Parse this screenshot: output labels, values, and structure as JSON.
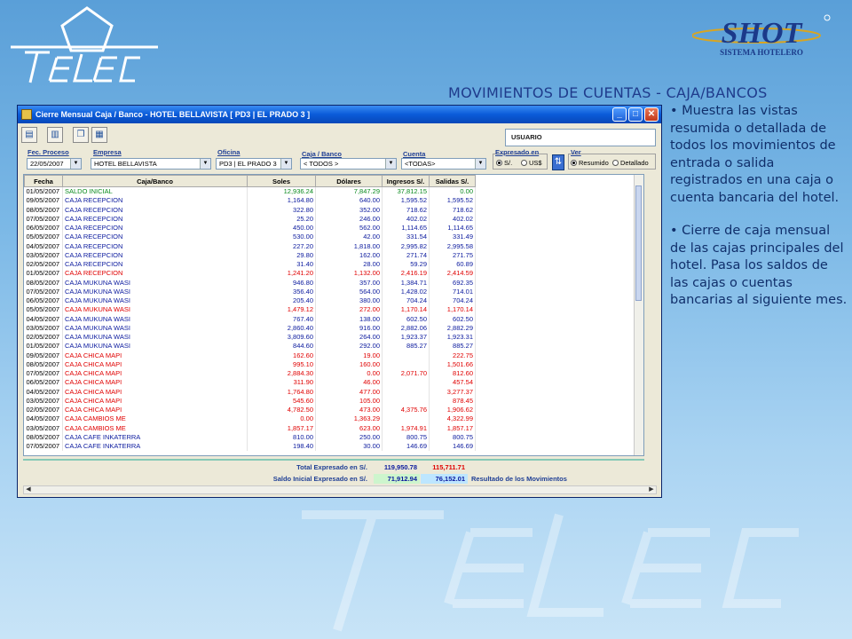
{
  "slide": {
    "title": "MOVIMIENTOS DE CUENTAS - CAJA/BANCOS",
    "brand_left": "TELECSA",
    "brand_right": "SHOT",
    "brand_right_sub": "SISTEMA HOTELERO",
    "bullets": [
      "• Muestra las vistas resumida o detallada de todos los movimientos de entrada o salida registrados en una caja o cuenta bancaria del hotel.",
      "• Cierre de caja mensual de las cajas principales del hotel. Pasa los saldos de las cajas o cuentas bancarias al siguiente mes."
    ]
  },
  "window": {
    "title": "Cierre Mensual Caja / Banco - HOTEL BELLAVISTA  [ PD3  |  EL PRADO 3 ]",
    "usuario_label": "USUARIO"
  },
  "filters": {
    "fec_proceso_label": "Fec. Proceso",
    "fec_proceso_value": "22/05/2007",
    "empresa_label": "Empresa",
    "empresa_value": "HOTEL BELLAVISTA",
    "oficina_label": "Oficina",
    "oficina_value": "PD3  |  EL PRADO 3",
    "caja_label": "Caja / Banco",
    "caja_value": "< TODOS >",
    "cuenta_label": "Cuenta",
    "cuenta_value": "<TODAS>",
    "expresado_label": "Expresado en",
    "expresado_opt1": "S/.",
    "expresado_opt2": "US$",
    "ver_label": "Ver",
    "ver_opt1": "Resumido",
    "ver_opt2": "Detallado"
  },
  "table": {
    "headers": [
      "Fecha",
      "Caja/Banco",
      "Soles",
      "Dólares",
      "Ingresos S/.",
      "Salidas S/."
    ],
    "rows": [
      {
        "fecha": "01/05/2007",
        "caja": "SALDO INICIAL",
        "soles": "12,936.24",
        "dolares": "7,847.29",
        "ingresos": "37,812.15",
        "salidas": "0.00",
        "color": "green"
      },
      {
        "fecha": "09/05/2007",
        "caja": "CAJA RECEPCION",
        "soles": "1,164.80",
        "dolares": "640.00",
        "ingresos": "1,595.52",
        "salidas": "1,595.52",
        "color": "blue"
      },
      {
        "fecha": "08/05/2007",
        "caja": "CAJA RECEPCION",
        "soles": "322.80",
        "dolares": "352.00",
        "ingresos": "718.62",
        "salidas": "718.62",
        "color": "blue"
      },
      {
        "fecha": "07/05/2007",
        "caja": "CAJA RECEPCION",
        "soles": "25.20",
        "dolares": "246.00",
        "ingresos": "402.02",
        "salidas": "402.02",
        "color": "blue"
      },
      {
        "fecha": "06/05/2007",
        "caja": "CAJA RECEPCION",
        "soles": "450.00",
        "dolares": "562.00",
        "ingresos": "1,114.65",
        "salidas": "1,114.65",
        "color": "blue"
      },
      {
        "fecha": "05/05/2007",
        "caja": "CAJA RECEPCION",
        "soles": "530.00",
        "dolares": "42.00",
        "ingresos": "331.54",
        "salidas": "331.49",
        "color": "blue"
      },
      {
        "fecha": "04/05/2007",
        "caja": "CAJA RECEPCION",
        "soles": "227.20",
        "dolares": "1,818.00",
        "ingresos": "2,995.82",
        "salidas": "2,995.58",
        "color": "blue"
      },
      {
        "fecha": "03/05/2007",
        "caja": "CAJA RECEPCION",
        "soles": "29.80",
        "dolares": "162.00",
        "ingresos": "271.74",
        "salidas": "271.75",
        "color": "blue"
      },
      {
        "fecha": "02/05/2007",
        "caja": "CAJA RECEPCION",
        "soles": "31.40",
        "dolares": "28.00",
        "ingresos": "59.29",
        "salidas": "60.89",
        "color": "blue"
      },
      {
        "fecha": "01/05/2007",
        "caja": "CAJA RECEPCION",
        "soles": "1,241.20",
        "dolares": "1,132.00",
        "ingresos": "2,416.19",
        "salidas": "2,414.59",
        "color": "red"
      },
      {
        "fecha": "08/05/2007",
        "caja": "CAJA MUKUNA WASI",
        "soles": "946.80",
        "dolares": "357.00",
        "ingresos": "1,384.71",
        "salidas": "692.35",
        "color": "blue"
      },
      {
        "fecha": "07/05/2007",
        "caja": "CAJA MUKUNA WASI",
        "soles": "356.40",
        "dolares": "564.00",
        "ingresos": "1,428.02",
        "salidas": "714.01",
        "color": "blue"
      },
      {
        "fecha": "06/05/2007",
        "caja": "CAJA MUKUNA WASI",
        "soles": "205.40",
        "dolares": "380.00",
        "ingresos": "704.24",
        "salidas": "704.24",
        "color": "blue"
      },
      {
        "fecha": "05/05/2007",
        "caja": "CAJA MUKUNA WASI",
        "soles": "1,479.12",
        "dolares": "272.00",
        "ingresos": "1,170.14",
        "salidas": "1,170.14",
        "color": "red"
      },
      {
        "fecha": "04/05/2007",
        "caja": "CAJA MUKUNA WASI",
        "soles": "767.40",
        "dolares": "138.00",
        "ingresos": "602.50",
        "salidas": "602.50",
        "color": "blue"
      },
      {
        "fecha": "03/05/2007",
        "caja": "CAJA MUKUNA WASI",
        "soles": "2,860.40",
        "dolares": "916.00",
        "ingresos": "2,882.06",
        "salidas": "2,882.29",
        "color": "blue"
      },
      {
        "fecha": "02/05/2007",
        "caja": "CAJA MUKUNA WASI",
        "soles": "3,809.60",
        "dolares": "264.00",
        "ingresos": "1,923.37",
        "salidas": "1,923.31",
        "color": "blue"
      },
      {
        "fecha": "01/05/2007",
        "caja": "CAJA MUKUNA WASI",
        "soles": "844.60",
        "dolares": "292.00",
        "ingresos": "885.27",
        "salidas": "885.27",
        "color": "blue"
      },
      {
        "fecha": "09/05/2007",
        "caja": "CAJA CHICA MAPI",
        "soles": "162.60",
        "dolares": "19.00",
        "ingresos": "",
        "salidas": "222.75",
        "color": "red"
      },
      {
        "fecha": "08/05/2007",
        "caja": "CAJA CHICA MAPI",
        "soles": "995.10",
        "dolares": "160.00",
        "ingresos": "",
        "salidas": "1,501.66",
        "color": "red"
      },
      {
        "fecha": "07/05/2007",
        "caja": "CAJA CHICA MAPI",
        "soles": "2,884.30",
        "dolares": "0.00",
        "ingresos": "2,071.70",
        "salidas": "812.60",
        "color": "red"
      },
      {
        "fecha": "06/05/2007",
        "caja": "CAJA CHICA MAPI",
        "soles": "311.90",
        "dolares": "46.00",
        "ingresos": "",
        "salidas": "457.54",
        "color": "red"
      },
      {
        "fecha": "04/05/2007",
        "caja": "CAJA CHICA MAPI",
        "soles": "1,764.80",
        "dolares": "477.00",
        "ingresos": "",
        "salidas": "3,277.37",
        "color": "red"
      },
      {
        "fecha": "03/05/2007",
        "caja": "CAJA CHICA MAPI",
        "soles": "545.60",
        "dolares": "105.00",
        "ingresos": "",
        "salidas": "878.45",
        "color": "red"
      },
      {
        "fecha": "02/05/2007",
        "caja": "CAJA CHICA MAPI",
        "soles": "4,782.50",
        "dolares": "473.00",
        "ingresos": "4,375.76",
        "salidas": "1,906.62",
        "color": "red"
      },
      {
        "fecha": "04/05/2007",
        "caja": "CAJA CAMBIOS ME",
        "soles": "0.00",
        "dolares": "1,363.29",
        "ingresos": "",
        "salidas": "4,322.99",
        "color": "red"
      },
      {
        "fecha": "03/05/2007",
        "caja": "CAJA CAMBIOS ME",
        "soles": "1,857.17",
        "dolares": "623.00",
        "ingresos": "1,974.91",
        "salidas": "1,857.17",
        "color": "red"
      },
      {
        "fecha": "08/05/2007",
        "caja": "CAJA CAFE INKATERRA",
        "soles": "810.00",
        "dolares": "250.00",
        "ingresos": "800.75",
        "salidas": "800.75",
        "color": "blue"
      },
      {
        "fecha": "07/05/2007",
        "caja": "CAJA CAFE INKATERRA",
        "soles": "198.40",
        "dolares": "30.00",
        "ingresos": "146.69",
        "salidas": "146.69",
        "color": "blue"
      }
    ]
  },
  "totals": {
    "total_label": "Total Expresado en  S/.",
    "total_ingresos": "119,950.78",
    "total_salidas": "115,711.71",
    "saldo_label": "Saldo Inicial Expresado en  S/.",
    "saldo_soles": "71,912.94",
    "saldo_dolares": "76,152.01",
    "resultado_label": "Resultado de los Movimientos"
  },
  "colors": {
    "blue": "#0b1a9e",
    "red": "#e00000",
    "green": "#0a8a1e",
    "accent": "#0a5bd9"
  }
}
